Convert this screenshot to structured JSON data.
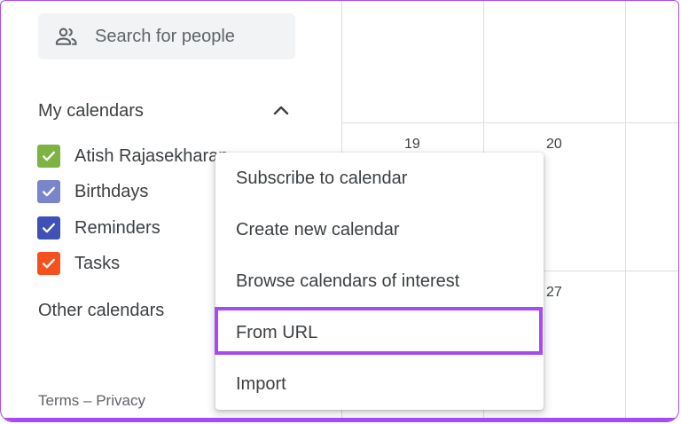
{
  "search": {
    "placeholder": "Search for people",
    "icon": "people-icon"
  },
  "my_calendars": {
    "title": "My calendars",
    "items": [
      {
        "label": "Atish Rajasekharan",
        "color": "#7cb342"
      },
      {
        "label": "Birthdays",
        "color": "#7986cb"
      },
      {
        "label": "Reminders",
        "color": "#3f51b5"
      },
      {
        "label": "Tasks",
        "color": "#f4511e"
      }
    ]
  },
  "other_calendars": {
    "title": "Other calendars"
  },
  "footer": {
    "terms": "Terms",
    "separator": "–",
    "privacy": "Privacy"
  },
  "grid": {
    "days": [
      "19",
      "20",
      "27"
    ]
  },
  "menu": {
    "items": [
      "Subscribe to calendar",
      "Create new calendar",
      "Browse calendars of interest",
      "From URL",
      "Import"
    ],
    "highlighted": "From URL"
  },
  "colors": {
    "accent_highlight": "#a64bf4"
  }
}
